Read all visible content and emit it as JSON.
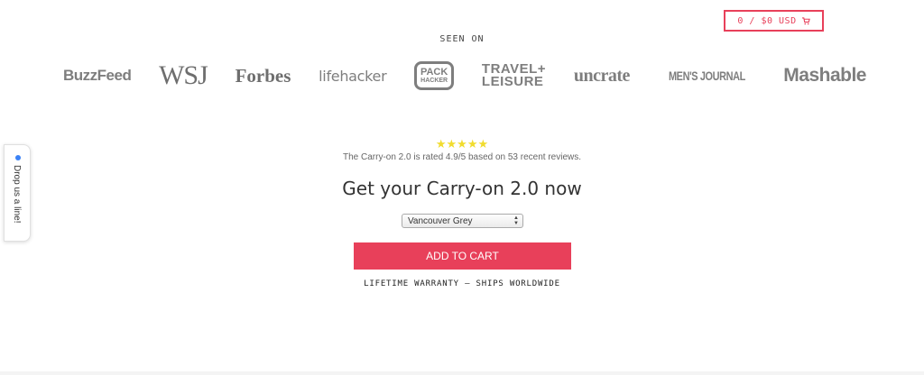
{
  "cart": {
    "label": "0 / $0 USD",
    "icon": "cart-icon",
    "accent_color": "#e8405a"
  },
  "seen_on": {
    "heading": "SEEN ON",
    "logos": {
      "buzzfeed": "BuzzFeed",
      "wsj": "WSJ",
      "forbes": "Forbes",
      "lifehacker": "lifehacker",
      "packhacker_line1": "PACK",
      "packhacker_line2": "HACKER",
      "travel_line1": "TRAVEL+",
      "travel_line2": "LEISURE",
      "uncrate": "uncrate",
      "mensjournal": "MEN'S JOURNAL",
      "mashable": "Mashable"
    }
  },
  "product": {
    "stars": "★★★★★",
    "star_rating": 5,
    "star_color": "#f1dc2e",
    "rating_text": "The Carry-on 2.0 is rated 4.9/5 based on 53 recent reviews.",
    "headline": "Get your Carry-on 2.0 now",
    "variant_selected": "Vancouver Grey",
    "add_to_cart_label": "ADD TO CART",
    "button_color": "#e8405a",
    "warranty_text": "LIFETIME WARRANTY — SHIPS WORLDWIDE"
  },
  "feedback": {
    "label": "Drop us a line!",
    "dot_color": "#3b82f6"
  }
}
